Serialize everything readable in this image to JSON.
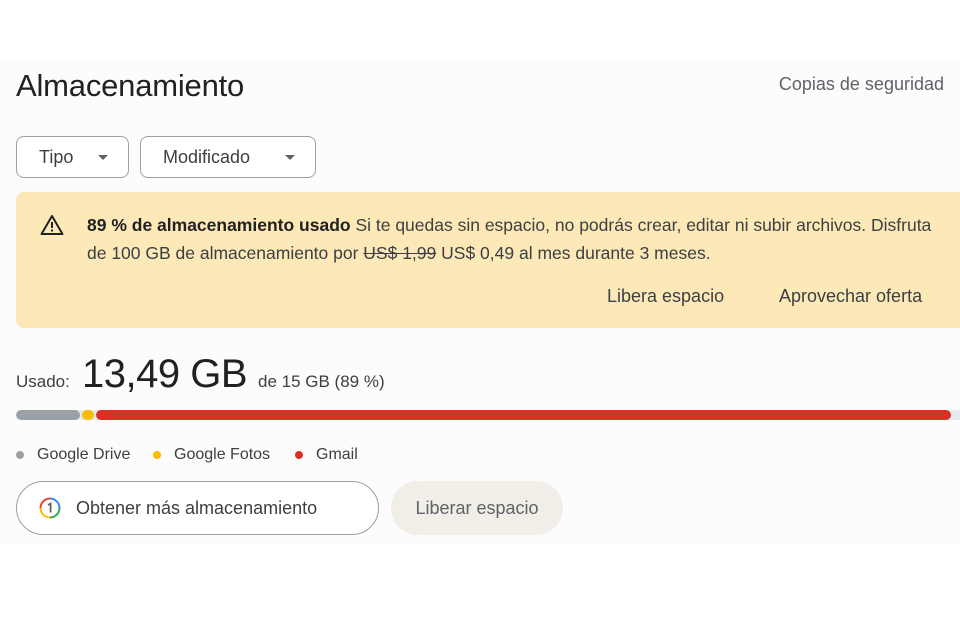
{
  "header": {
    "title": "Almacenamiento",
    "backups_link": "Copias de seguridad"
  },
  "filters": [
    {
      "label": "Tipo"
    },
    {
      "label": "Modificado"
    }
  ],
  "banner": {
    "icon": "warning-icon",
    "bold_text": "89 % de almacenamiento usado",
    "text_1": " Si te quedas sin espacio, no podrás crear, editar ni subir archivos. Disfruta de 100 GB de almacenamiento por ",
    "old_price": "US$ 1,99",
    "text_2": " US$ 0,49 al mes durante 3 meses.",
    "actions": {
      "free_space": "Libera espacio",
      "get_offer": "Aprovechar oferta"
    },
    "colors": {
      "background": "#fde9b7"
    }
  },
  "usage": {
    "label": "Usado:",
    "amount": "13,49 GB",
    "of_total": "de 15 GB (89 %)",
    "segments": [
      {
        "name": "Google Drive",
        "fraction": 0.07,
        "color": "#9aa0a6"
      },
      {
        "name": "Google Fotos",
        "fraction": 0.015,
        "color": "#fbbc04"
      },
      {
        "name": "Gmail",
        "fraction": 0.905,
        "color": "#d93025"
      }
    ]
  },
  "legend": [
    {
      "label": "Google Drive",
      "color": "#9aa0a6"
    },
    {
      "label": "Google Fotos",
      "color": "#fbbc04"
    },
    {
      "label": "Gmail",
      "color": "#d93025"
    }
  ],
  "buttons": {
    "get_more": "Obtener más almacenamiento",
    "get_more_icon": "google-one-icon",
    "free_space": "Liberar espacio"
  }
}
